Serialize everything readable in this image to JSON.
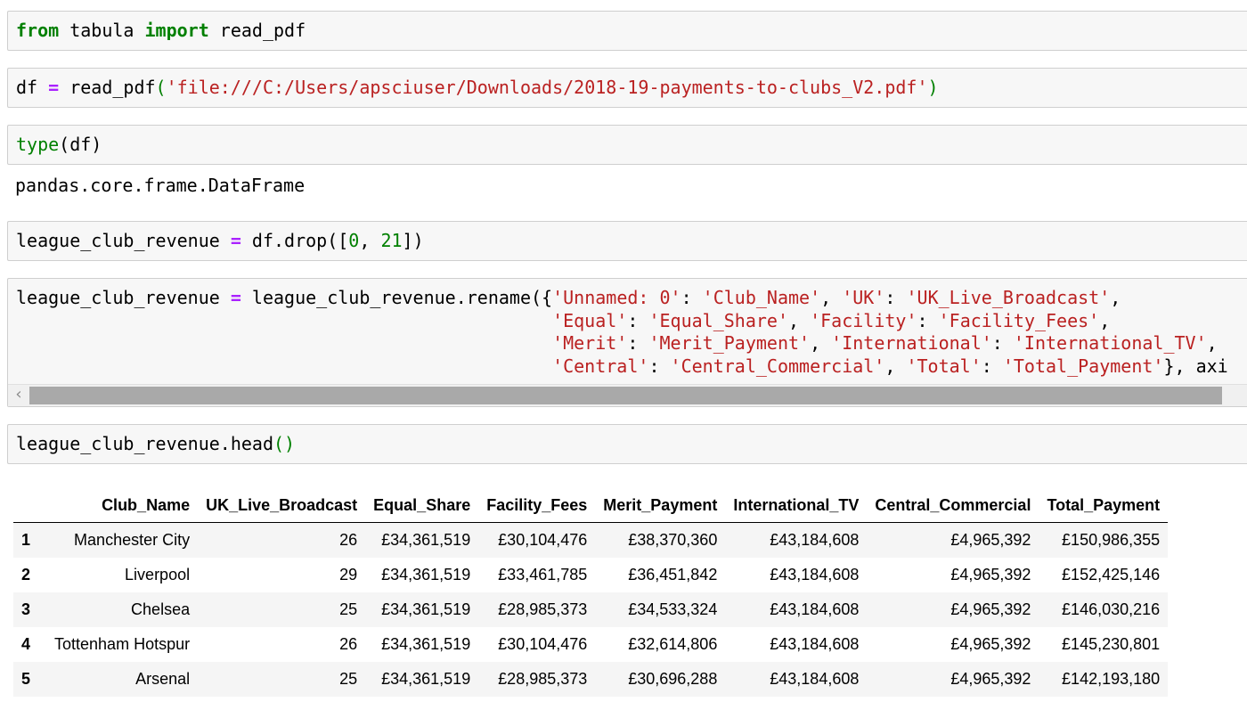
{
  "cells": [
    {
      "tokens": [
        {
          "t": "from",
          "c": "kw"
        },
        {
          "t": " tabula ",
          "c": ""
        },
        {
          "t": "import",
          "c": "kw"
        },
        {
          "t": " read_pdf",
          "c": ""
        }
      ]
    },
    {
      "tokens": [
        {
          "t": "df ",
          "c": ""
        },
        {
          "t": "=",
          "c": "op"
        },
        {
          "t": " read_pdf",
          "c": ""
        },
        {
          "t": "(",
          "c": "paren"
        },
        {
          "t": "'file:///C:/Users/apsciuser/Downloads/2018-19-payments-to-clubs_V2.pdf'",
          "c": "str"
        },
        {
          "t": ")",
          "c": "paren"
        }
      ]
    },
    {
      "tokens": [
        {
          "t": "type",
          "c": "paren"
        },
        {
          "t": "(df)",
          "c": ""
        }
      ]
    },
    {
      "tokens": [
        {
          "t": "league_club_revenue ",
          "c": ""
        },
        {
          "t": "=",
          "c": "op"
        },
        {
          "t": " df.drop([",
          "c": ""
        },
        {
          "t": "0",
          "c": "num"
        },
        {
          "t": ", ",
          "c": ""
        },
        {
          "t": "21",
          "c": "num"
        },
        {
          "t": "])",
          "c": ""
        }
      ]
    },
    {
      "tokens": [
        {
          "t": "league_club_revenue ",
          "c": ""
        },
        {
          "t": "=",
          "c": "op"
        },
        {
          "t": " league_club_revenue.rename({",
          "c": ""
        },
        {
          "t": "'Unnamed: 0'",
          "c": "str"
        },
        {
          "t": ": ",
          "c": ""
        },
        {
          "t": "'Club_Name'",
          "c": "str"
        },
        {
          "t": ", ",
          "c": ""
        },
        {
          "t": "'UK'",
          "c": "str"
        },
        {
          "t": ": ",
          "c": ""
        },
        {
          "t": "'UK_Live_Broadcast'",
          "c": "str"
        },
        {
          "t": ",\n                                                  ",
          "c": ""
        },
        {
          "t": "'Equal'",
          "c": "str"
        },
        {
          "t": ": ",
          "c": ""
        },
        {
          "t": "'Equal_Share'",
          "c": "str"
        },
        {
          "t": ", ",
          "c": ""
        },
        {
          "t": "'Facility'",
          "c": "str"
        },
        {
          "t": ": ",
          "c": ""
        },
        {
          "t": "'Facility_Fees'",
          "c": "str"
        },
        {
          "t": ",\n                                                  ",
          "c": ""
        },
        {
          "t": "'Merit'",
          "c": "str"
        },
        {
          "t": ": ",
          "c": ""
        },
        {
          "t": "'Merit_Payment'",
          "c": "str"
        },
        {
          "t": ", ",
          "c": ""
        },
        {
          "t": "'International'",
          "c": "str"
        },
        {
          "t": ": ",
          "c": ""
        },
        {
          "t": "'International_TV'",
          "c": "str"
        },
        {
          "t": ",\n                                                  ",
          "c": ""
        },
        {
          "t": "'Central'",
          "c": "str"
        },
        {
          "t": ": ",
          "c": ""
        },
        {
          "t": "'Central_Commercial'",
          "c": "str"
        },
        {
          "t": ", ",
          "c": ""
        },
        {
          "t": "'Total'",
          "c": "str"
        },
        {
          "t": ": ",
          "c": ""
        },
        {
          "t": "'Total_Payment'",
          "c": "str"
        },
        {
          "t": "}, axi",
          "c": ""
        }
      ]
    },
    {
      "tokens": [
        {
          "t": "league_club_revenue.head",
          "c": ""
        },
        {
          "t": "()",
          "c": "paren"
        }
      ]
    }
  ],
  "output_type_text": "pandas.core.frame.DataFrame",
  "scrollbar": {
    "left_arrow_icon": "chevron-left-icon"
  },
  "table": {
    "columns": [
      "Club_Name",
      "UK_Live_Broadcast",
      "Equal_Share",
      "Facility_Fees",
      "Merit_Payment",
      "International_TV",
      "Central_Commercial",
      "Total_Payment"
    ],
    "rows": [
      {
        "index": "1",
        "cells": [
          "Manchester City",
          "26",
          "£34,361,519",
          "£30,104,476",
          "£38,370,360",
          "£43,184,608",
          "£4,965,392",
          "£150,986,355"
        ]
      },
      {
        "index": "2",
        "cells": [
          "Liverpool",
          "29",
          "£34,361,519",
          "£33,461,785",
          "£36,451,842",
          "£43,184,608",
          "£4,965,392",
          "£152,425,146"
        ]
      },
      {
        "index": "3",
        "cells": [
          "Chelsea",
          "25",
          "£34,361,519",
          "£28,985,373",
          "£34,533,324",
          "£43,184,608",
          "£4,965,392",
          "£146,030,216"
        ]
      },
      {
        "index": "4",
        "cells": [
          "Tottenham Hotspur",
          "26",
          "£34,361,519",
          "£30,104,476",
          "£32,614,806",
          "£43,184,608",
          "£4,965,392",
          "£145,230,801"
        ]
      },
      {
        "index": "5",
        "cells": [
          "Arsenal",
          "25",
          "£34,361,519",
          "£28,985,373",
          "£30,696,288",
          "£43,184,608",
          "£4,965,392",
          "£142,193,180"
        ]
      }
    ]
  }
}
